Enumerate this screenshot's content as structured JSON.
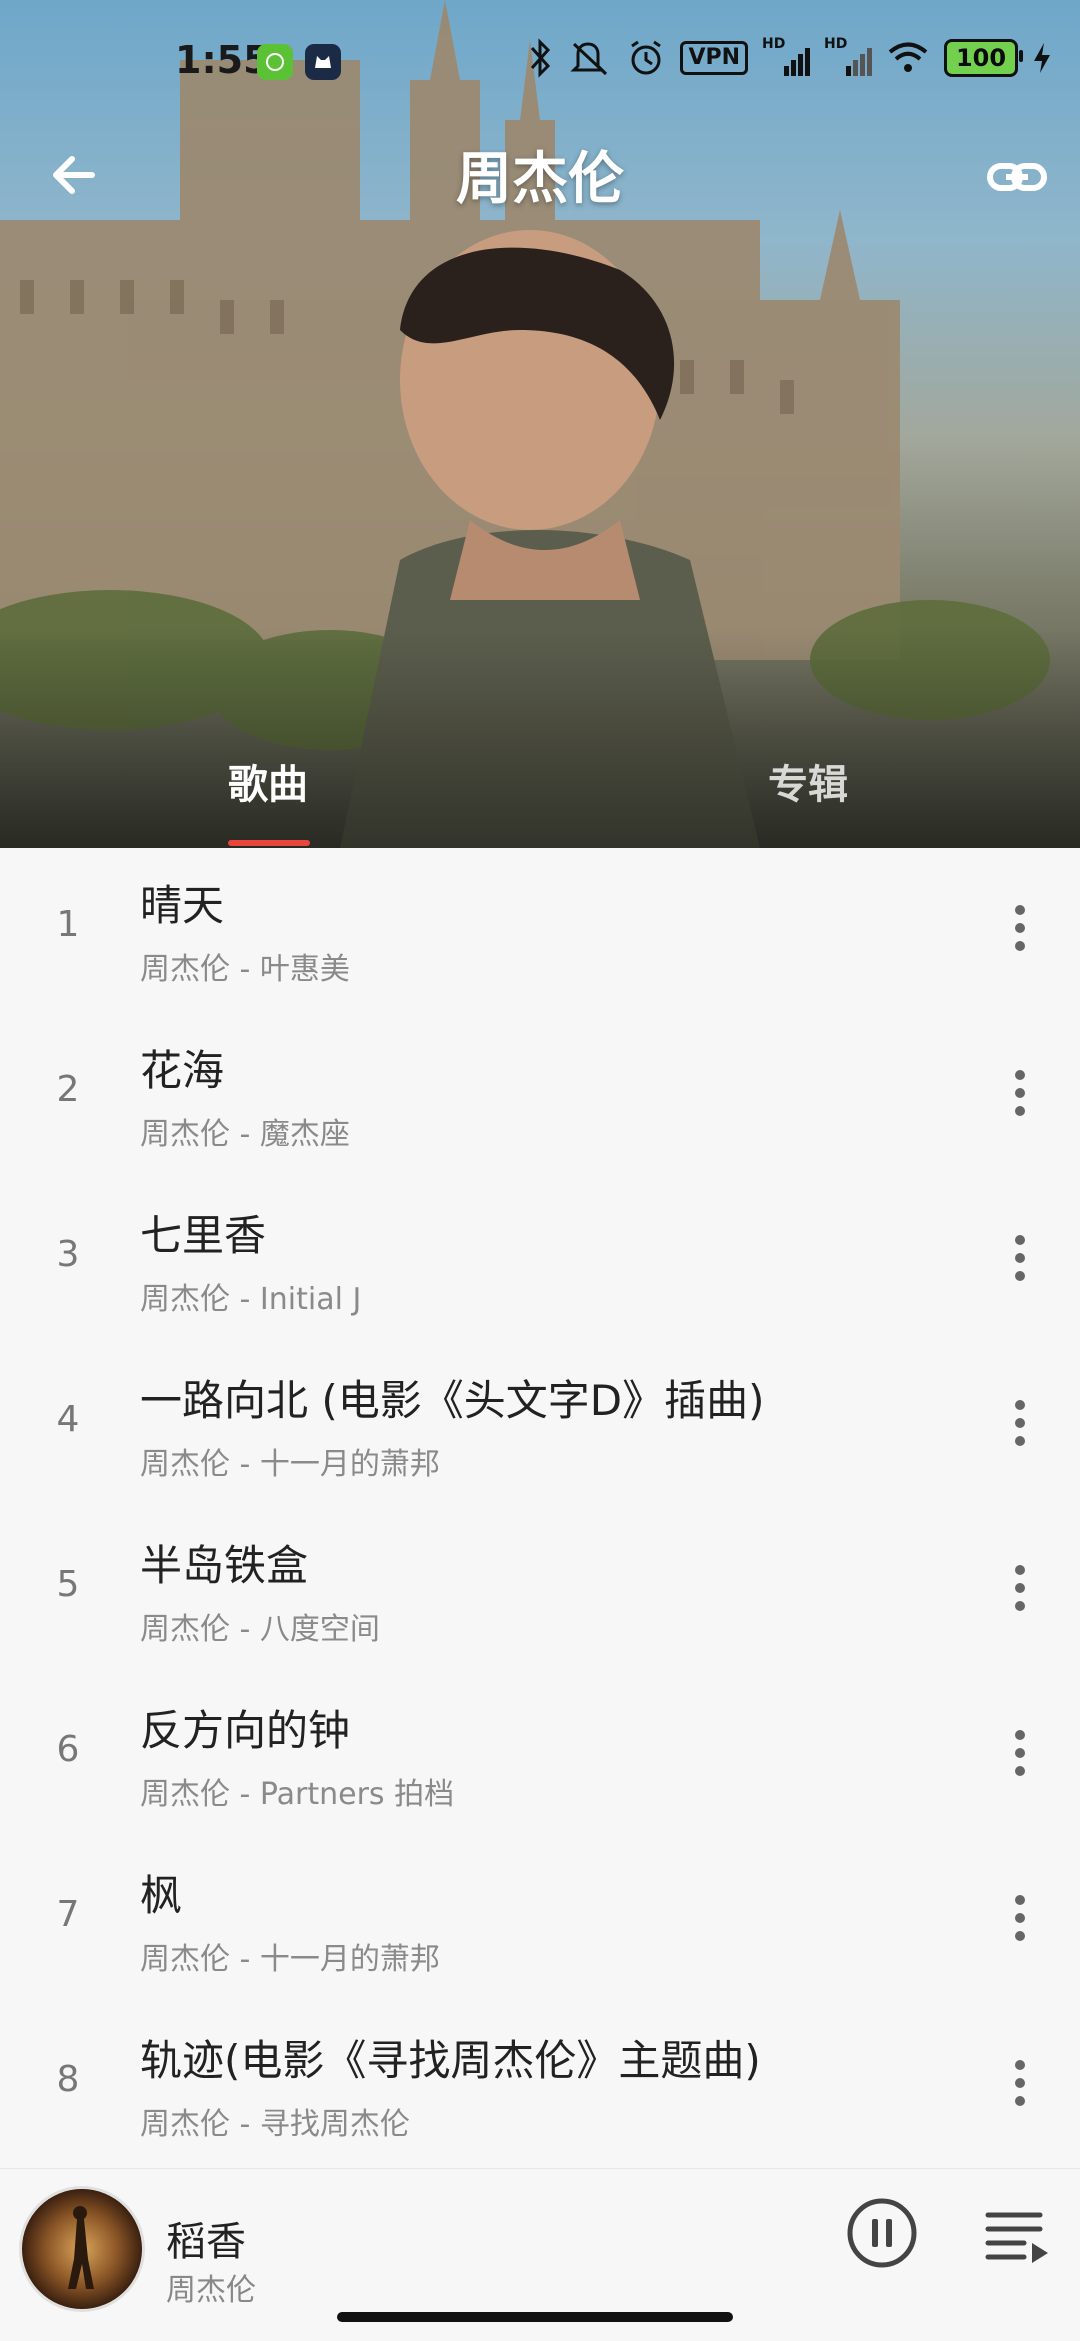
{
  "status_bar": {
    "time": "1:55",
    "vpn_label": "VPN",
    "hd1": "HD",
    "hd2": "HD",
    "battery": "100",
    "icons": [
      "app-badge-green-icon",
      "app-badge-dark-icon",
      "bluetooth-icon",
      "mute-icon",
      "alarm-icon",
      "vpn-icon",
      "signal-icon",
      "signal-icon",
      "wifi-icon",
      "battery-icon",
      "charging-icon"
    ]
  },
  "header": {
    "title": "周杰伦",
    "back_icon": "back-arrow-icon",
    "link_icon": "link-icon"
  },
  "tabs": [
    {
      "label": "歌曲",
      "active": true
    },
    {
      "label": "专辑",
      "active": false
    }
  ],
  "songs": [
    {
      "index": "1",
      "title": "晴天",
      "subtitle": "周杰伦 - 叶惠美"
    },
    {
      "index": "2",
      "title": "花海",
      "subtitle": "周杰伦 - 魔杰座"
    },
    {
      "index": "3",
      "title": "七里香",
      "subtitle": "周杰伦 - Initial J"
    },
    {
      "index": "4",
      "title": "一路向北 (电影《头文字D》插曲)",
      "subtitle": "周杰伦 - 十一月的萧邦"
    },
    {
      "index": "5",
      "title": "半岛铁盒",
      "subtitle": "周杰伦 - 八度空间"
    },
    {
      "index": "6",
      "title": "反方向的钟",
      "subtitle": "周杰伦 - Partners 拍档"
    },
    {
      "index": "7",
      "title": "枫",
      "subtitle": "周杰伦 - 十一月的萧邦"
    },
    {
      "index": "8",
      "title": "轨迹(电影《寻找周杰伦》主题曲)",
      "subtitle": "周杰伦 - 寻找周杰伦"
    }
  ],
  "player": {
    "title": "稻香",
    "artist": "周杰伦",
    "pause_icon": "pause-icon",
    "queue_icon": "playlist-icon"
  },
  "colors": {
    "accent": "#e8453c",
    "background": "#f7f7f7"
  }
}
